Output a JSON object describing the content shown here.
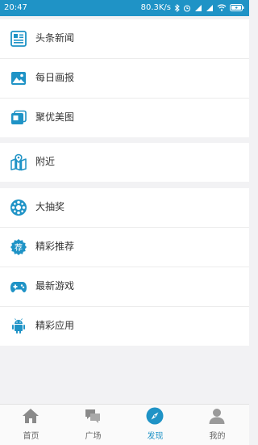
{
  "status_bar": {
    "time": "20:47",
    "net_speed": "80.3K/s",
    "battery_icon": "battery-charging-icon"
  },
  "sections": [
    {
      "items": [
        {
          "label": "头条新闻",
          "icon": "newspaper-icon"
        },
        {
          "label": "每日画报",
          "icon": "picture-icon"
        },
        {
          "label": "聚优美图",
          "icon": "gallery-icon"
        }
      ]
    },
    {
      "items": [
        {
          "label": "附近",
          "icon": "map-location-icon"
        }
      ]
    },
    {
      "items": [
        {
          "label": "大抽奖",
          "icon": "lottery-wheel-icon"
        },
        {
          "label": "精彩推荐",
          "icon": "recommend-badge-icon"
        },
        {
          "label": "最新游戏",
          "icon": "gamepad-icon"
        },
        {
          "label": "精彩应用",
          "icon": "android-icon"
        }
      ]
    }
  ],
  "tabbar": {
    "tabs": [
      {
        "label": "首页",
        "icon": "home-icon"
      },
      {
        "label": "广场",
        "icon": "chat-bubbles-icon"
      },
      {
        "label": "发现",
        "icon": "compass-icon",
        "active": true
      },
      {
        "label": "我的",
        "icon": "user-icon"
      }
    ]
  },
  "colors": {
    "accent": "#1f93c6",
    "background": "#f2f2f4"
  }
}
